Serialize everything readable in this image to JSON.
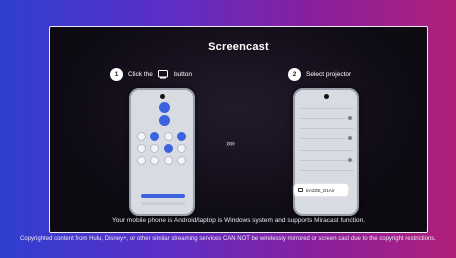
{
  "card": {
    "title": "Screencast",
    "steps": [
      {
        "number": "1",
        "label_before": "Click the",
        "icon": "cast-icon",
        "label_after": "button"
      },
      {
        "number": "2",
        "label": "Select projector"
      }
    ],
    "arrows": "››››",
    "projector_name": "EAZZE_D1Air",
    "caption": "Your mobile phone is Android/laptop is Windows system and supports Miracast function."
  },
  "footer_note": "Copyrighted content from Hulu, Disney+, or other similar streaming services CAN NOT be wirelessly mirrored or screen cast due to the copyright restrictions."
}
